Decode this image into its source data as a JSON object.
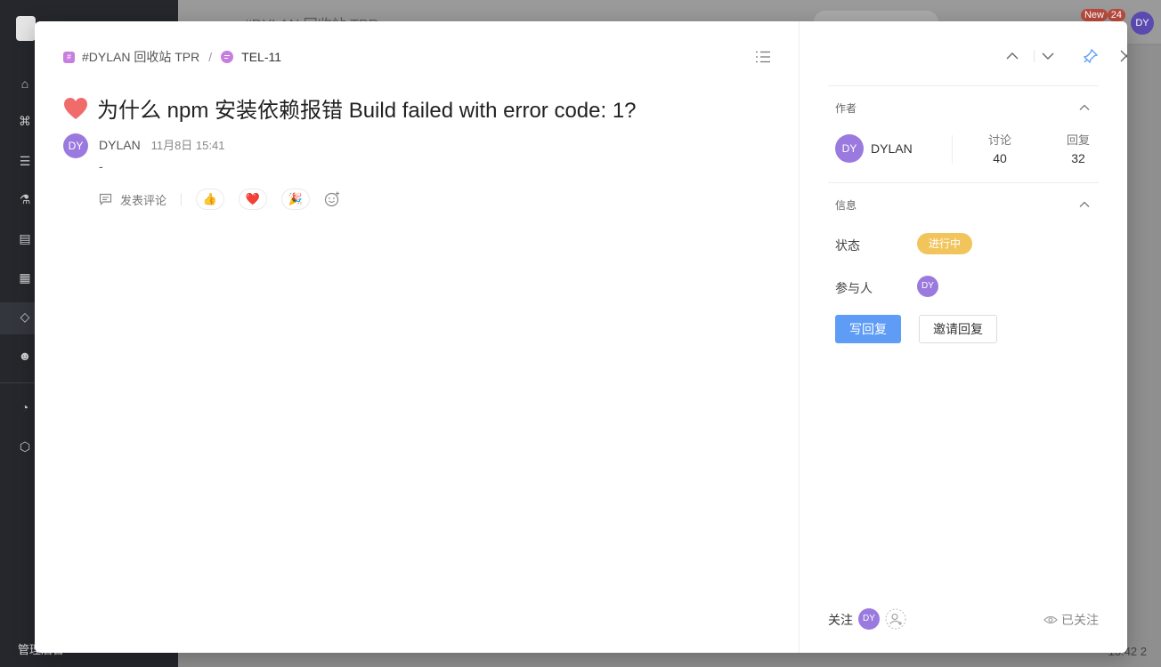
{
  "background": {
    "sidebar_bottom_label": "管理后台",
    "top_title": "#DYLAN 回收站 TPR",
    "badge_new": "New",
    "badge_count": "24",
    "top_avatar": "DY",
    "bottom_right": "13:42  2"
  },
  "breadcrumb": {
    "channel_icon": "#",
    "channel": "#DYLAN 回收站 TPR",
    "separator": "/",
    "topic_id": "TEL-11"
  },
  "topic": {
    "title": "为什么 npm 安装依赖报错 Build failed with error code: 1?"
  },
  "post": {
    "avatar": "DY",
    "author": "DYLAN",
    "time": "11月8日 15:41",
    "body": "-",
    "comment_label": "发表评论",
    "reactions": [
      {
        "name": "thumbs-up",
        "emoji": "👍"
      },
      {
        "name": "heart",
        "emoji": "❤️"
      },
      {
        "name": "party-popper",
        "emoji": "🎉"
      }
    ]
  },
  "panel": {
    "author_section": "作者",
    "author_avatar": "DY",
    "author_name": "DYLAN",
    "discussions_label": "讨论",
    "discussions_value": "40",
    "replies_label": "回复",
    "replies_value": "32",
    "info_section": "信息",
    "status_label": "状态",
    "status_value": "进行中",
    "participants_label": "参与人",
    "participant_avatar": "DY",
    "reply_button": "写回复",
    "invite_button": "邀请回复",
    "follow_label": "关注",
    "follower_avatar": "DY",
    "followed_status": "已关注"
  },
  "colors": {
    "accent": "#5e9cf6",
    "avatar": "#9b7ae0",
    "status_badge": "#f2c55c",
    "channel_icon": "#c77ede",
    "heart": "#f26b6b"
  }
}
